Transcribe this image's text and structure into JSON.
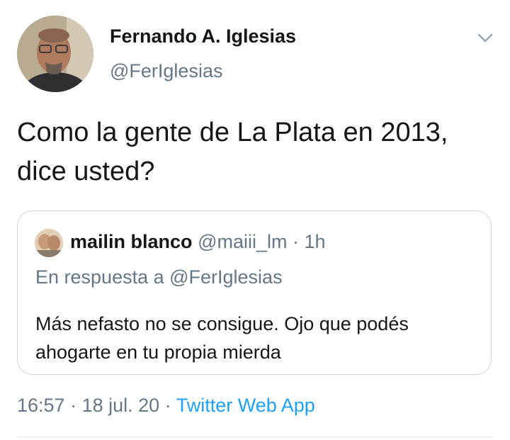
{
  "tweet": {
    "author_name": "Fernando A. Iglesias",
    "author_handle": "@FerIglesias",
    "text": "Como la gente de La Plata en 2013, dice usted?",
    "time": "16:57",
    "separator": " · ",
    "date": "18 jul. 20",
    "source": "Twitter Web App",
    "menu_icon": "chevron-down-icon"
  },
  "quoted": {
    "name": "mailin blanco",
    "handle": "@maiii_lm",
    "separator": " · ",
    "age": "1h",
    "reply_to": "En respuesta a @FerIglesias",
    "text": "Más nefasto no se consigue. Ojo que podés ahogarte en tu propia mierda"
  },
  "colors": {
    "text_primary": "#14171a",
    "text_secondary": "#657786",
    "link": "#1da1f2",
    "border": "#ccd6dd"
  }
}
